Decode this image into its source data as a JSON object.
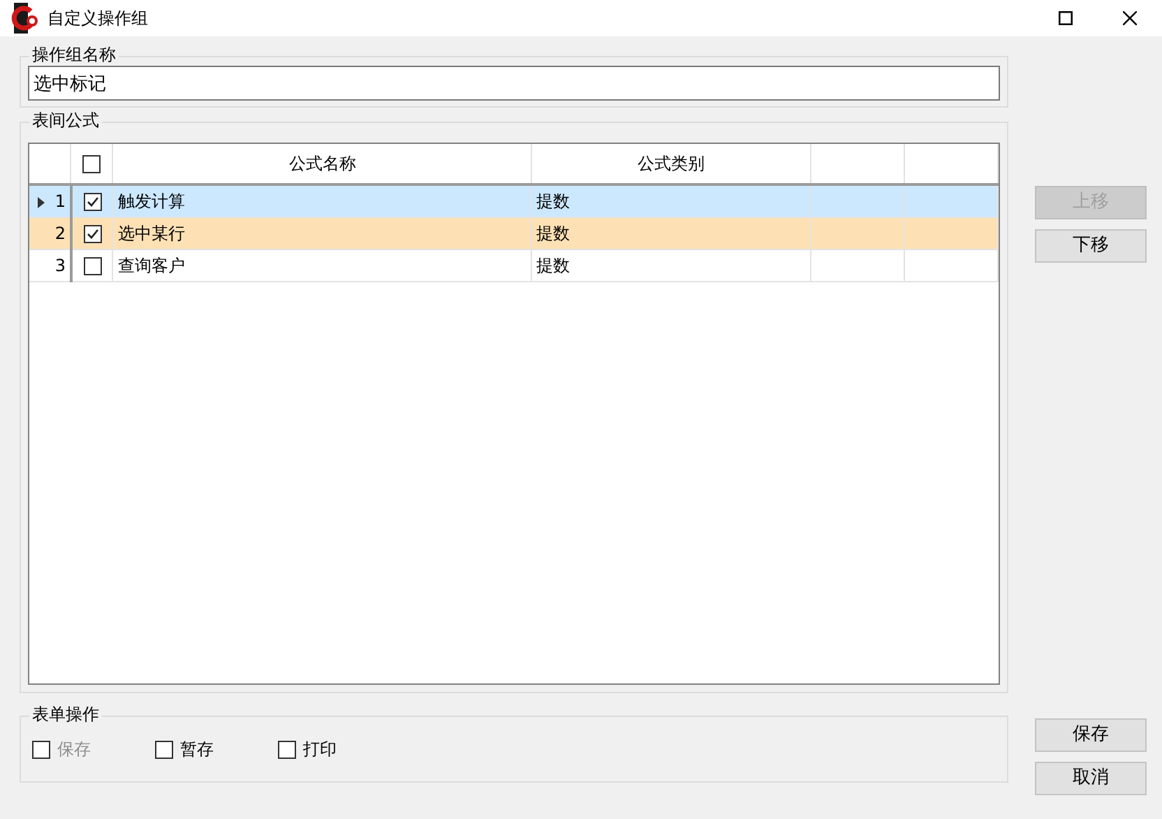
{
  "window": {
    "title": "自定义操作组"
  },
  "group_name": {
    "legend": "操作组名称",
    "value": "选中标记"
  },
  "formulas": {
    "legend": "表间公式",
    "header_checked": false,
    "columns": [
      "公式名称",
      "公式类别",
      "",
      ""
    ],
    "rows": [
      {
        "number": "1",
        "checked": true,
        "selected": true,
        "highlighted": false,
        "name": "触发计算",
        "category": "提数"
      },
      {
        "number": "2",
        "checked": true,
        "selected": false,
        "highlighted": true,
        "name": "选中某行",
        "category": "提数"
      },
      {
        "number": "3",
        "checked": false,
        "selected": false,
        "highlighted": false,
        "name": "查询客户",
        "category": "提数"
      }
    ]
  },
  "move_buttons": [
    {
      "label": "上移",
      "disabled": true
    },
    {
      "label": "下移",
      "disabled": false
    }
  ],
  "form_actions": {
    "legend": "表单操作",
    "items": [
      {
        "label": "保存",
        "checked": false,
        "disabled": true
      },
      {
        "label": "暂存",
        "checked": false,
        "disabled": false
      },
      {
        "label": "打印",
        "checked": false,
        "disabled": false
      }
    ]
  },
  "dialog_buttons": [
    {
      "label": "保存"
    },
    {
      "label": "取消"
    }
  ]
}
